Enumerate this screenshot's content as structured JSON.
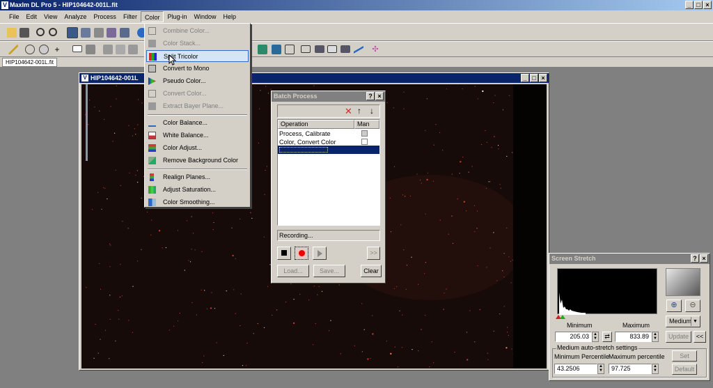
{
  "app": {
    "title": "MaxIm DL Pro 5 - HIP104642-001L.fit"
  },
  "menubar": [
    "File",
    "Edit",
    "View",
    "Analyze",
    "Process",
    "Filter",
    "Color",
    "Plug-in",
    "Window",
    "Help"
  ],
  "document_tab": "HIP104642-001L.fit",
  "image_window": {
    "title": "HIP104642-001L"
  },
  "color_menu": {
    "items": [
      {
        "label": "Combine Color...",
        "disabled": true
      },
      {
        "label": "Color Stack...",
        "disabled": true
      },
      {
        "label": "Split Tricolor",
        "highlighted": true
      },
      {
        "label": "Convert to Mono"
      },
      {
        "label": "Pseudo Color..."
      },
      {
        "label": "Convert Color...",
        "disabled": true
      },
      {
        "label": "Extract Bayer Plane...",
        "disabled": true
      },
      {
        "label": "Color Balance..."
      },
      {
        "label": "White Balance..."
      },
      {
        "label": "Color Adjust..."
      },
      {
        "label": "Remove Background Color"
      },
      {
        "label": "Realign Planes..."
      },
      {
        "label": "Adjust Saturation..."
      },
      {
        "label": "Color Smoothing..."
      }
    ]
  },
  "batch": {
    "title": "Batch Process",
    "col_operation": "Operation",
    "col_man": "Man",
    "rows": [
      {
        "operation": "Process, Calibrate",
        "man": false
      },
      {
        "operation": "Color, Convert Color",
        "man": false
      }
    ],
    "status": "Recording...",
    "load_label": "Load...",
    "save_label": "Save...",
    "clear_label": "Clear",
    "forward_label": ">>"
  },
  "stretch": {
    "title": "Screen Stretch",
    "min_label": "Minimum",
    "max_label": "Maximum",
    "min_value": "205.03",
    "max_value": "833.89",
    "mode": "Medium",
    "update_label": "Update",
    "back_label": "<<",
    "auto_group": "Medium auto-stretch settings",
    "min_pct_label": "Minimum Percentile",
    "max_pct_label": "Maximum percentile",
    "min_pct": "43.2506",
    "max_pct": "97.725",
    "set_label": "Set",
    "default_label": "Default"
  },
  "colors": {
    "titlebar": "#0a246a",
    "highlight": "#316ac5",
    "face": "#d4d0c8",
    "sky": "#160b08"
  }
}
